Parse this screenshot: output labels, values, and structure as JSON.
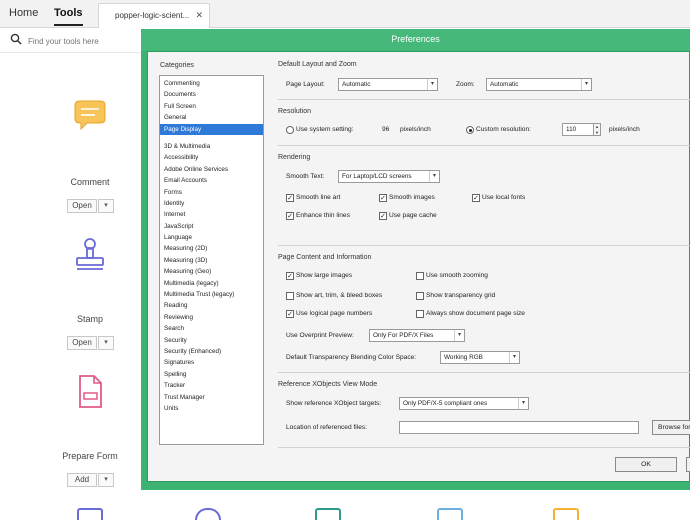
{
  "topbar": {
    "home_label": "Home",
    "tools_label": "Tools",
    "doc_tab_label": "popper-logic-scient...",
    "doc_tab_close": "✕"
  },
  "search": {
    "placeholder": "Find your tools here"
  },
  "tools": [
    {
      "name": "Comment",
      "button": "Open",
      "dropdown": "▾",
      "icon": "comment-icon",
      "color": "#f5b335"
    },
    {
      "name": "Stamp",
      "button": "Open",
      "dropdown": "▾",
      "icon": "stamp-icon",
      "color": "#6a6ad8"
    },
    {
      "name": "Prepare Form",
      "button": "Add",
      "dropdown": "▾",
      "icon": "prepare-form-icon",
      "color": "#e05b8a"
    }
  ],
  "dialog": {
    "title": "Preferences",
    "categories_label": "Categories",
    "categories_top": [
      "Commenting",
      "Documents",
      "Full Screen",
      "General",
      "Page Display"
    ],
    "categories_bottom": [
      "3D & Multimedia",
      "Accessibility",
      "Adobe Online Services",
      "Email Accounts",
      "Forms",
      "Identity",
      "Internet",
      "JavaScript",
      "Language",
      "Measuring (2D)",
      "Measuring (3D)",
      "Measuring (Geo)",
      "Multimedia (legacy)",
      "Multimedia Trust (legacy)",
      "Reading",
      "Reviewing",
      "Search",
      "Security",
      "Security (Enhanced)",
      "Signatures",
      "Spelling",
      "Tracker",
      "Trust Manager",
      "Units"
    ],
    "selected_category": "Page Display",
    "layout_section": "Default Layout and Zoom",
    "page_layout_label": "Page Layout:",
    "page_layout_value": "Automatic",
    "zoom_label": "Zoom:",
    "zoom_value": "Automatic",
    "resolution_section": "Resolution",
    "use_system_label": "Use system setting:",
    "system_res_value": "96",
    "pixels_inch_1": "pixels/inch",
    "custom_res_label": "Custom resolution:",
    "custom_res_value": "110",
    "pixels_inch_2": "pixels/inch",
    "rendering_section": "Rendering",
    "smooth_text_label": "Smooth Text:",
    "smooth_text_value": "For Laptop/LCD screens",
    "smooth_line_art": "Smooth line art",
    "smooth_images": "Smooth images",
    "use_local_fonts": "Use local fonts",
    "enhance_thin_lines": "Enhance thin lines",
    "use_page_cache": "Use page cache",
    "page_content_section": "Page Content and Information",
    "show_large_images": "Show large images",
    "use_smooth_zooming": "Use smooth zooming",
    "show_art_trim": "Show art, trim, & bleed boxes",
    "show_transparency_grid": "Show transparency grid",
    "use_logical_page_numbers": "Use logical page numbers",
    "always_show_page_size": "Always show document page size",
    "overprint_label": "Use Overprint Preview:",
    "overprint_value": "Only For PDF/X Files",
    "blending_label": "Default Transparency Blending Color Space:",
    "blending_value": "Working RGB",
    "xobjects_section": "Reference XObjects View Mode",
    "show_xobject_label": "Show reference XObject targets:",
    "show_xobject_value": "Only PDF/X-5 compliant ones",
    "location_label": "Location of referenced files:",
    "browse_label": "Browse for Location...",
    "ok_label": "OK",
    "caret": "▾",
    "check": "✓",
    "spin_up": "▲",
    "spin_down": "▼"
  }
}
